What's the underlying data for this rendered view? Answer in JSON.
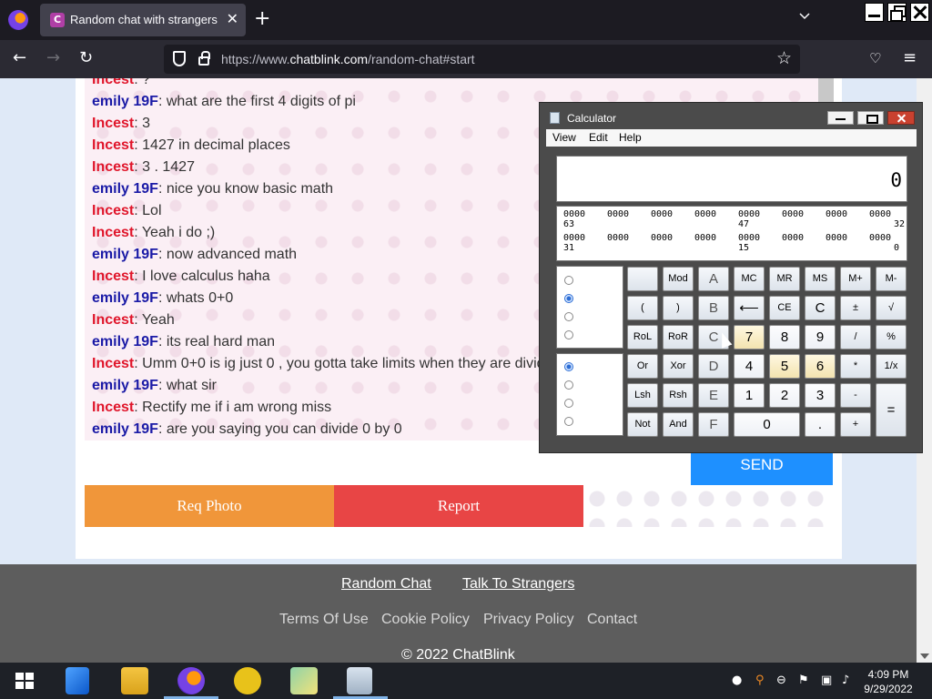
{
  "browser": {
    "tab_title": "Random chat with strangers",
    "tab_favicon_letter": "C",
    "url_prefix": "https://www.",
    "url_domain": "chatblink.com",
    "url_path": "/random-chat#start"
  },
  "chat": {
    "messages": [
      {
        "sender": "Incest",
        "text": ": ?"
      },
      {
        "sender": "emily 19F",
        "text": ": what are the first 4 digits of pi"
      },
      {
        "sender": "Incest",
        "text": ": 3"
      },
      {
        "sender": "Incest",
        "text": ": 1427 in decimal places"
      },
      {
        "sender": "Incest",
        "text": ": 3 . 1427"
      },
      {
        "sender": "emily 19F",
        "text": ": nice you know basic math"
      },
      {
        "sender": "Incest",
        "text": ": Lol"
      },
      {
        "sender": "Incest",
        "text": ": Yeah i do ;)"
      },
      {
        "sender": "emily 19F",
        "text": ": now advanced math"
      },
      {
        "sender": "Incest",
        "text": ": I love calculus haha"
      },
      {
        "sender": "emily 19F",
        "text": ": whats 0+0"
      },
      {
        "sender": "Incest",
        "text": ": Yeah"
      },
      {
        "sender": "emily 19F",
        "text": ": its real hard man"
      },
      {
        "sender": "Incest",
        "text": ": Umm 0+0 is ig just 0 , you gotta take limits when they are divid"
      },
      {
        "sender": "emily 19F",
        "text": ": what sir"
      },
      {
        "sender": "Incest",
        "text": ": Rectify me if i am wrong miss"
      },
      {
        "sender": "emily 19F",
        "text": ": are you saying you can divide 0 by 0"
      }
    ],
    "send_label": "SEND",
    "req_photo_label": "Req Photo",
    "report_label": "Report"
  },
  "footer": {
    "random_chat": "Random Chat",
    "talk_to_strangers": "Talk To Strangers",
    "terms": "Terms Of Use",
    "cookie": "Cookie Policy",
    "privacy": "Privacy Policy",
    "contact": "Contact",
    "copyright": "© 2022 ChatBlink"
  },
  "calculator": {
    "title": "Calculator",
    "menu": [
      "View",
      "Edit",
      "Help"
    ],
    "display": "0",
    "bits_row1": [
      "0000",
      "0000",
      "0000",
      "0000",
      "0000",
      "0000",
      "0000",
      "0000"
    ],
    "bits_row1_labels": [
      "63",
      "47",
      "32"
    ],
    "bits_row2": [
      "0000",
      "0000",
      "0000",
      "0000",
      "0000",
      "0000",
      "0000",
      "0000"
    ],
    "bits_row2_labels": [
      "31",
      "15",
      "0"
    ],
    "keys": [
      [
        "",
        "Mod",
        "A",
        "MC",
        "MR",
        "MS",
        "M+",
        "M-"
      ],
      [
        "(",
        ")",
        "B",
        "⟵",
        "CE",
        "C",
        "±",
        "√"
      ],
      [
        "RoL",
        "RoR",
        "C",
        "7",
        "8",
        "9",
        "/",
        "%"
      ],
      [
        "Or",
        "Xor",
        "D",
        "4",
        "5",
        "6",
        "*",
        "1/x"
      ],
      [
        "Lsh",
        "Rsh",
        "E",
        "1",
        "2",
        "3",
        "-",
        ""
      ],
      [
        "Not",
        "And",
        "F",
        "0",
        "",
        ".",
        "+",
        "="
      ]
    ]
  },
  "taskbar": {
    "time": "4:09 PM",
    "date": "9/29/2022"
  }
}
